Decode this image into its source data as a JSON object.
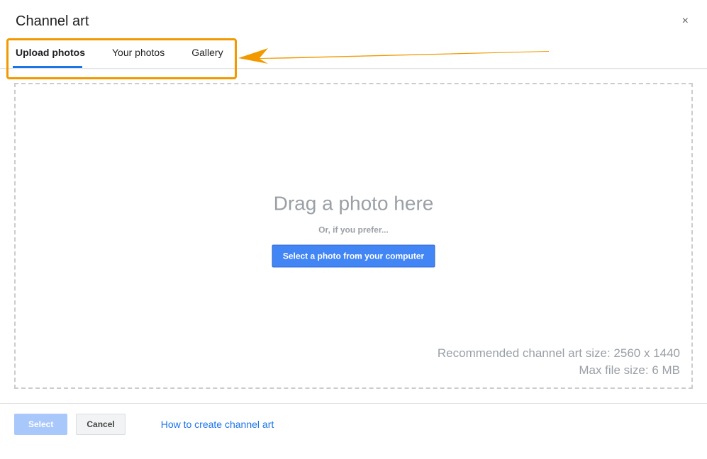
{
  "header": {
    "title": "Channel art",
    "close_icon": "×"
  },
  "tabs": {
    "upload": "Upload photos",
    "yours": "Your photos",
    "gallery": "Gallery"
  },
  "dropzone": {
    "drag_text": "Drag a photo here",
    "or_text": "Or, if you prefer...",
    "select_button": "Select a photo from your computer",
    "recommended": "Recommended channel art size: 2560 x 1440",
    "max_size": "Max file size: 6 MB"
  },
  "footer": {
    "select": "Select",
    "cancel": "Cancel",
    "link": "How to create channel art"
  },
  "annotation": {
    "highlight_color": "#f29900"
  }
}
